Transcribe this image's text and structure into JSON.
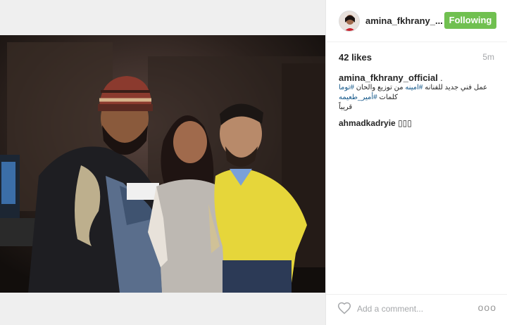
{
  "post": {
    "header": {
      "username": "amina_fkhrany_...",
      "follow_label": "Following"
    },
    "stats": {
      "likes": "42 likes",
      "time_ago": "5m"
    },
    "caption": {
      "author": "amina_fkhrany_official",
      "author_suffix": " .",
      "line1_plain": "عمل فني جديد للفنانه ",
      "line1_tag": "#امينه",
      "line1_rest": " من توزيع والحان ",
      "line1_tag2": "#توما",
      "line2_plain": "كلمات ",
      "line2_tag": "#أمير_طعيمه",
      "line3": "قريباً"
    },
    "comments": [
      {
        "author": "ahmadkadryie",
        "text": "▯▯▯"
      }
    ],
    "footer": {
      "comment_placeholder": "Add a comment...",
      "more_label": "ooo"
    },
    "colors": {
      "follow_button": "#70c050",
      "hashtag": "#125688",
      "muted": "#a5a7aa"
    },
    "icons": {
      "like": "heart-outline-icon",
      "more": "more-options-icon"
    }
  }
}
